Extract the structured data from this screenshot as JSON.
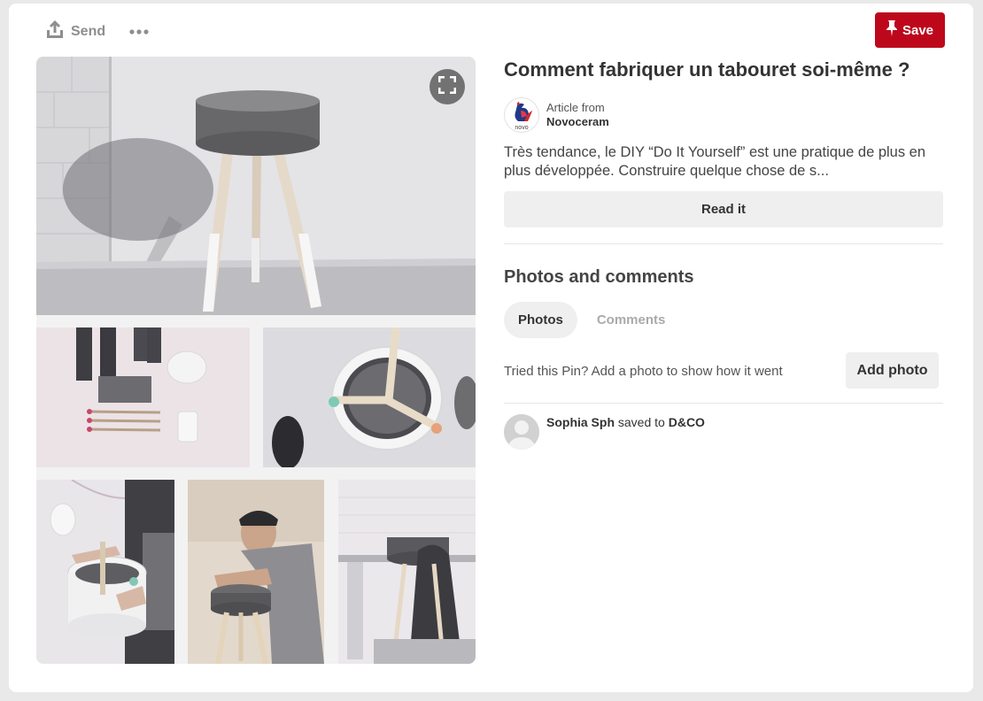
{
  "toolbar": {
    "send_label": "Send",
    "save_label": "Save"
  },
  "pin": {
    "title": "Comment fabriquer un tabouret soi-même ?",
    "source_label": "Article from",
    "source_name": "Novoceram",
    "source_logo_text": "novo",
    "description": "Très tendance, le DIY “Do It Yourself” est une pratique de plus en plus développée. Construire quelque chose de s...",
    "read_label": "Read it"
  },
  "comments_section": {
    "title": "Photos and comments",
    "tabs": [
      {
        "label": "Photos",
        "active": true
      },
      {
        "label": "Comments",
        "active": false
      }
    ],
    "tried_text": "Tried this Pin? Add a photo to show how it went",
    "add_photo_label": "Add photo"
  },
  "activity": {
    "user": "Sophia Sph",
    "action": "saved to",
    "board": "D&CO"
  },
  "colors": {
    "save_red": "#bd081c",
    "button_gray": "#efefef",
    "page_bg": "#e9e9e9"
  },
  "icons": [
    "share-icon",
    "more-icon",
    "pin-icon",
    "expand-icon",
    "rooster-logo-icon",
    "default-avatar-icon"
  ]
}
